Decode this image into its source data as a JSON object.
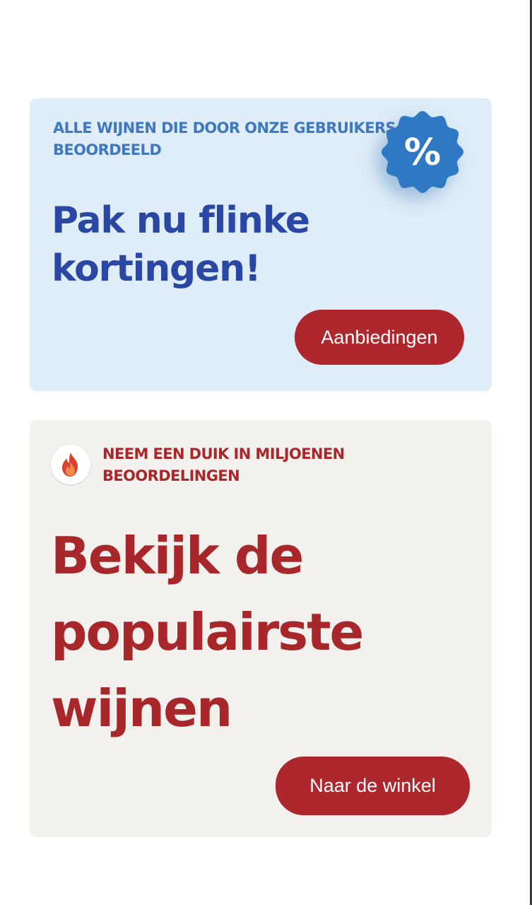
{
  "deals_card": {
    "eyebrow": "ALLE WIJNEN DIE DOOR ONZE GEBRUIKERS ZIJN BEOORDEELD",
    "headline": "Pak nu flinke kortingen!",
    "badge_symbol": "%",
    "badge_icon": "discount-badge-icon",
    "button_label": "Aanbiedingen",
    "colors": {
      "background": "#deedf8",
      "eyebrow": "#3f78bf",
      "headline": "#2a47a3",
      "badge": "#2f78c4"
    }
  },
  "popular_card": {
    "icon": "flame-icon",
    "eyebrow": "NEEM EEN DUIK IN MILJOENEN BEOORDELINGEN",
    "headline": "Bekijk de populairste wijnen",
    "button_label": "Naar de winkel",
    "colors": {
      "background": "#f3f1ee",
      "text": "#a8272b",
      "button": "#ad272d"
    }
  }
}
